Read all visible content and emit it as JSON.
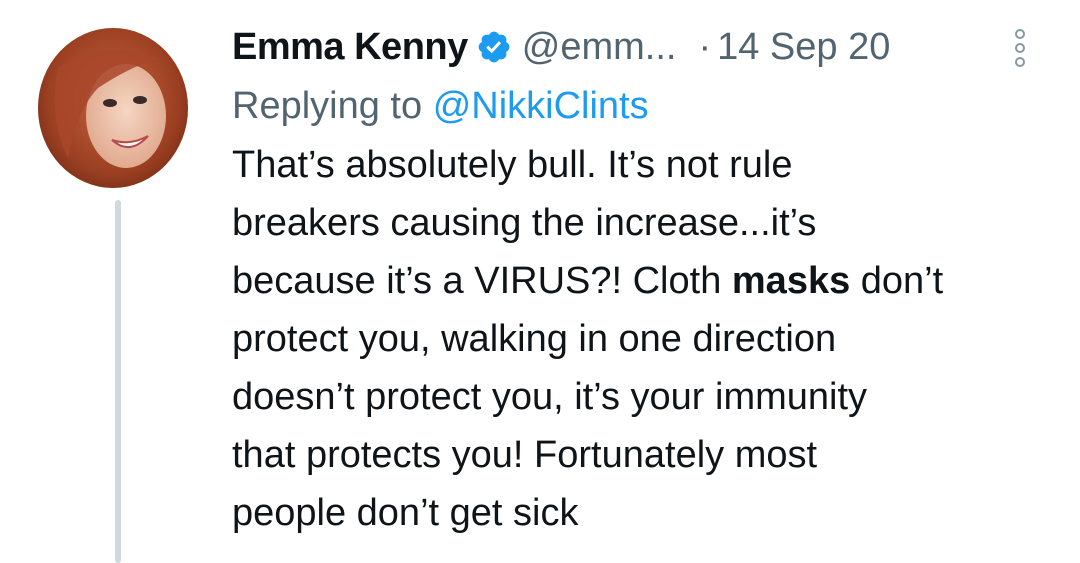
{
  "tweet": {
    "display_name": "Emma Kenny",
    "handle": "@emm...",
    "separator": "·",
    "date": "14 Sep 20",
    "replying_prefix": "Replying to",
    "replying_to": "@NikkiClints",
    "body_lines": [
      "That’s absolutely bull. It’s not rule",
      "breakers causing the increase...it’s"
    ],
    "body_line3_pre": "because it’s a VIRUS?! Cloth ",
    "body_line3_bold": "masks",
    "body_line3_post": " don’t",
    "body_lines_after": [
      "protect you, walking in one direction",
      "doesn’t protect you, it’s your immunity",
      "that protects you! Fortunately most",
      "people don’t get sick"
    ]
  },
  "icons": {
    "verified": "verified-badge-icon",
    "more": "more-options-icon"
  },
  "colors": {
    "name": "#0f1419",
    "secondary": "#536471",
    "link": "#1d9bf0",
    "thread_line": "#cfd9de"
  }
}
